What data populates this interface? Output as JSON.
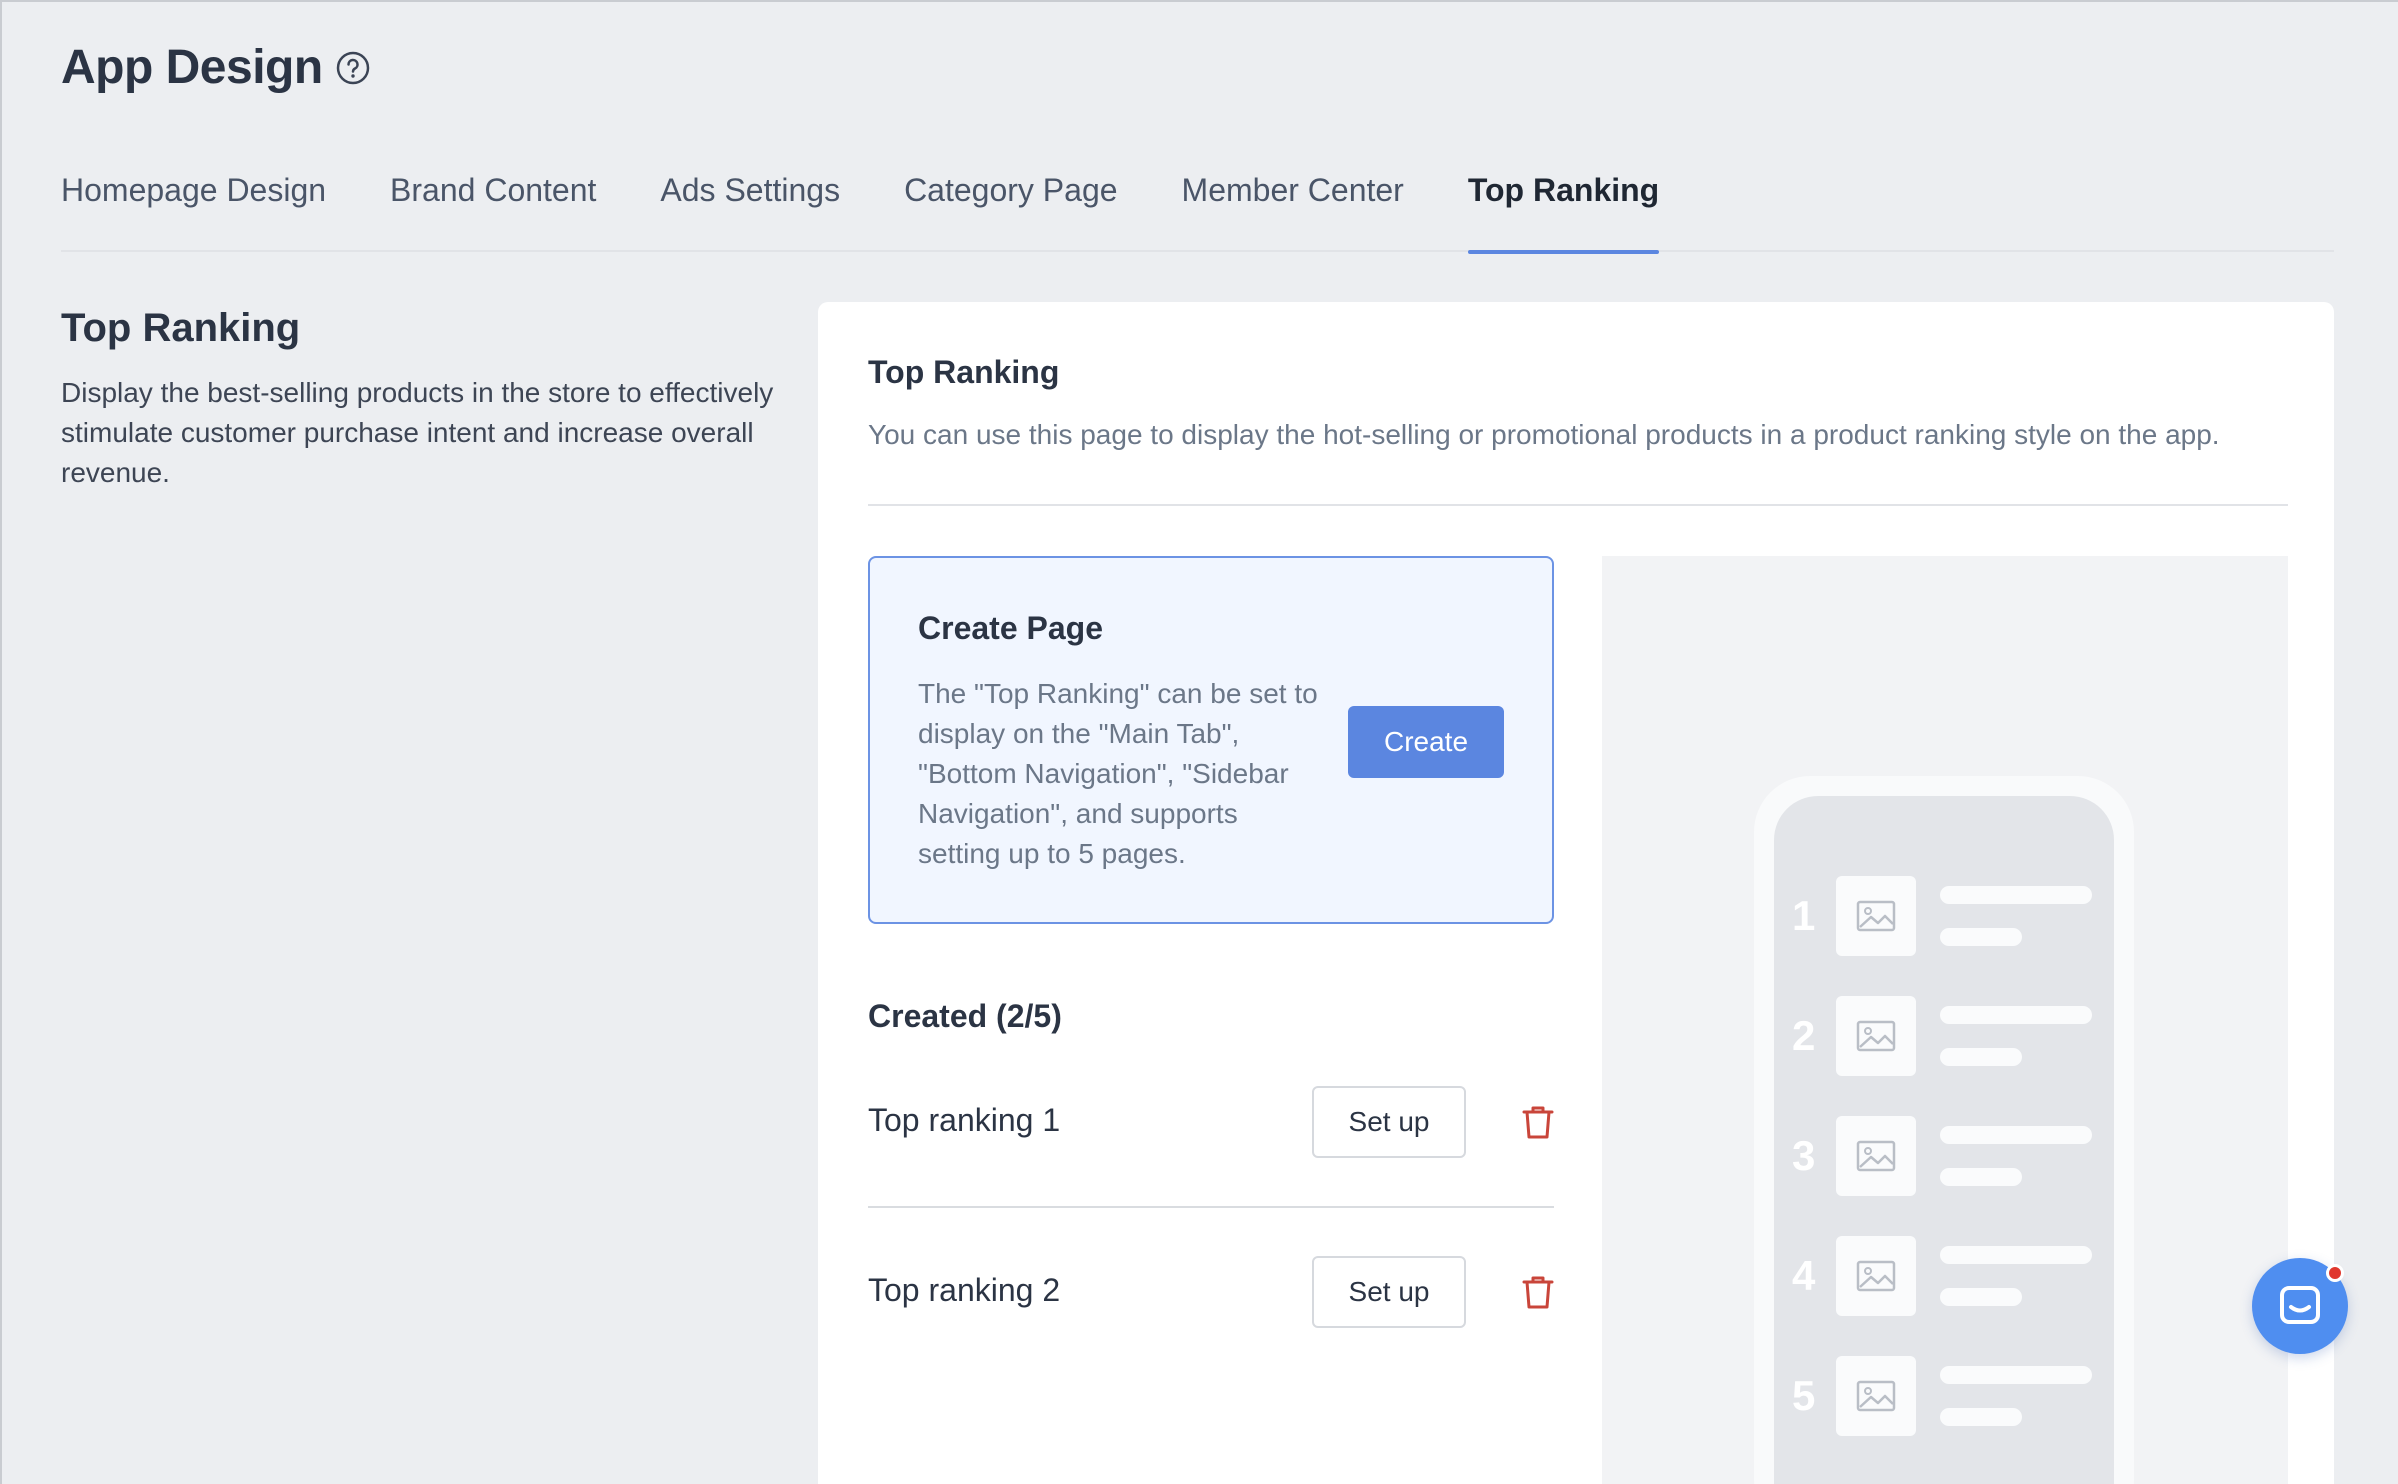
{
  "header": {
    "title": "App Design"
  },
  "tabs": [
    {
      "label": "Homepage Design"
    },
    {
      "label": "Brand Content"
    },
    {
      "label": "Ads Settings"
    },
    {
      "label": "Category Page"
    },
    {
      "label": "Member Center"
    },
    {
      "label": "Top Ranking",
      "active": true
    }
  ],
  "intro": {
    "title": "Top Ranking",
    "description": "Display the best-selling products in the store to effectively stimulate customer purchase intent and increase overall revenue."
  },
  "card": {
    "title": "Top Ranking",
    "subtitle": "You can use this page to display the hot-selling or promotional products in a product ranking style on the app.",
    "create": {
      "title": "Create Page",
      "description": "The \"Top Ranking\" can be set to display on the \"Main Tab\", \"Bottom Navigation\", \"Sidebar Navigation\", and supports setting up to 5 pages.",
      "button_label": "Create"
    },
    "created": {
      "heading": "Created (2/5)",
      "items": [
        {
          "label": "Top ranking 1",
          "button_label": "Set up"
        },
        {
          "label": "Top ranking 2",
          "button_label": "Set up"
        }
      ]
    }
  },
  "preview": {
    "ranks": [
      "1",
      "2",
      "3",
      "4",
      "5"
    ]
  },
  "colors": {
    "accent": "#5b86e0",
    "delete": "#c9453a",
    "chat": "#4f8ef0"
  },
  "icons": {
    "help": "help-circle-icon",
    "delete": "trash-icon",
    "image": "image-placeholder-icon",
    "chat": "chat-icon"
  }
}
